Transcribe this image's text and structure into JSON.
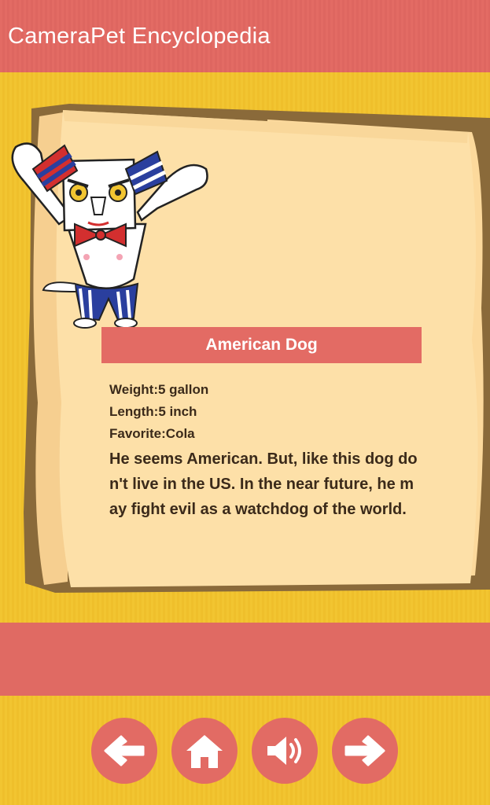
{
  "app": {
    "title": "CameraPet Encyclopedia"
  },
  "pet": {
    "name": "American Dog",
    "weight": "Weight:5 gallon",
    "length": "Length:5 inch",
    "favorite": "Favorite:Cola",
    "description": "He seems American. But, like this dog don't live in the US. In the near future, he may fight evil as a watchdog of the world."
  },
  "nav": {
    "buttons": [
      {
        "icon": "arrow-left-icon"
      },
      {
        "icon": "home-icon"
      },
      {
        "icon": "speaker-icon"
      },
      {
        "icon": "arrow-right-icon"
      }
    ]
  },
  "colors": {
    "header": "#e36b64",
    "background": "#f2c531",
    "page": "#fde0a8",
    "accent": "#e26b64"
  }
}
